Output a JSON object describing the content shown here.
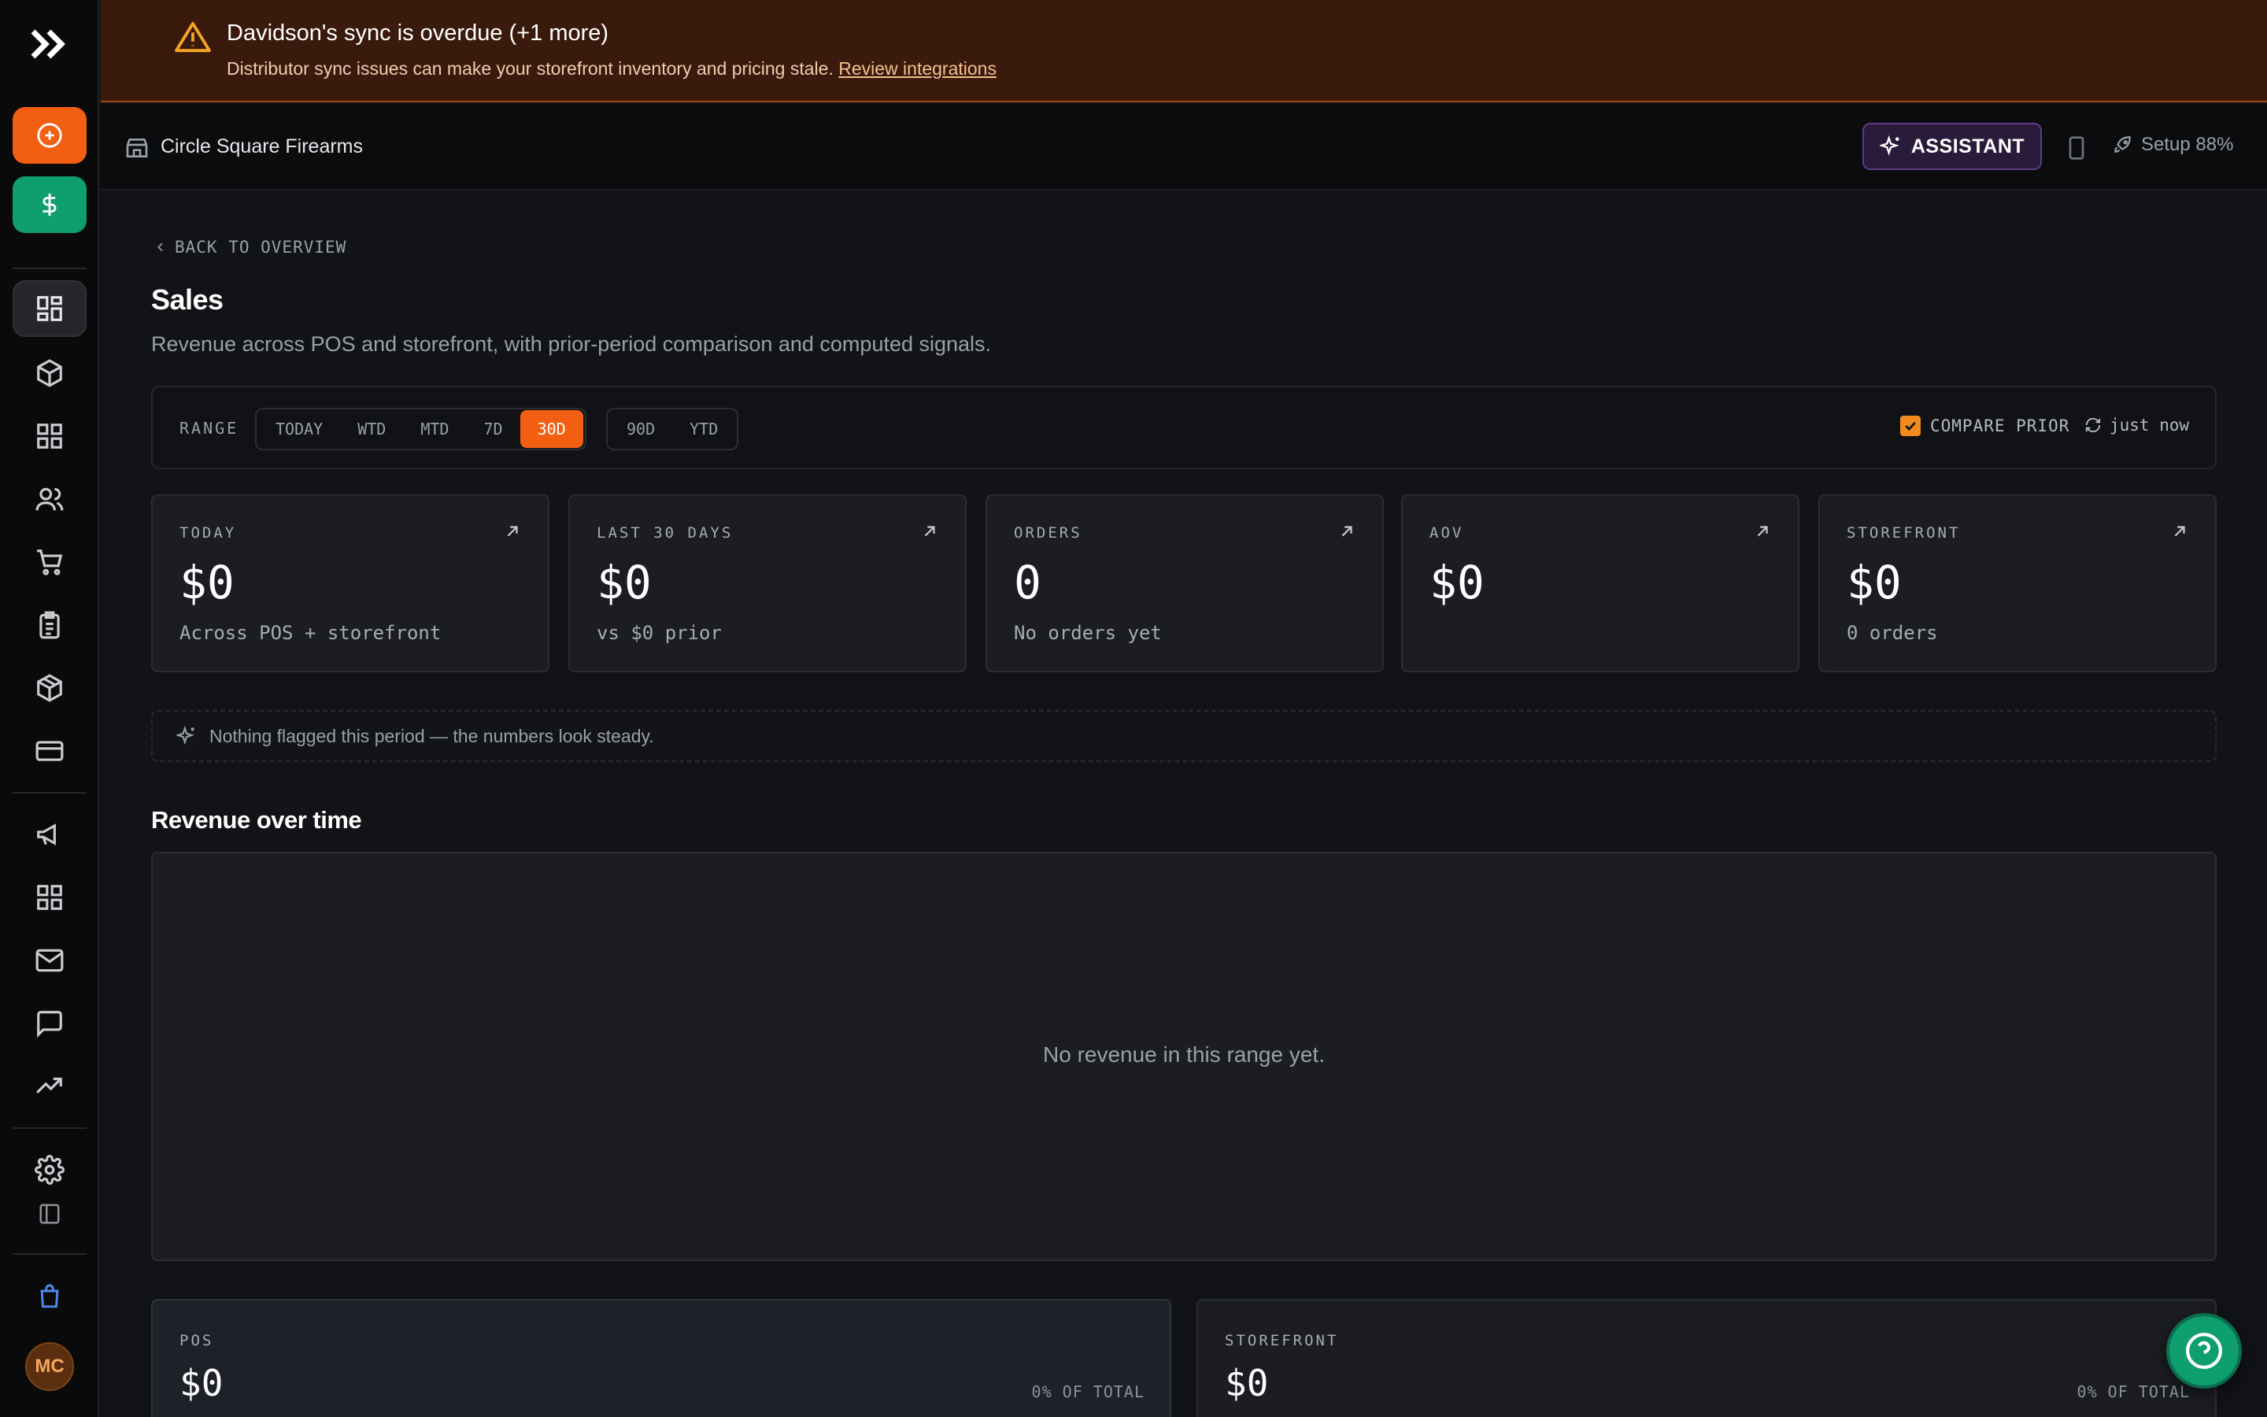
{
  "banner": {
    "title": "Davidson's sync is overdue (+1 more)",
    "text": "Distributor sync issues can make your storefront inventory and pricing stale.",
    "link": "Review integrations"
  },
  "topbar": {
    "store_name": "Circle Square Firearms",
    "assistant_label": "ASSISTANT",
    "setup_label": "Setup 88%"
  },
  "page": {
    "back_label": "BACK TO OVERVIEW",
    "title": "Sales",
    "subtitle": "Revenue across POS and storefront, with prior-period comparison and computed signals."
  },
  "range": {
    "label": "RANGE",
    "options_primary": [
      "TODAY",
      "WTD",
      "MTD",
      "7D",
      "30D"
    ],
    "options_secondary": [
      "90D",
      "YTD"
    ],
    "selected": "30D",
    "compare_label": "COMPARE PRIOR",
    "compare_checked": true,
    "refreshed_label": "just now"
  },
  "kpis": [
    {
      "label": "TODAY",
      "value": "$0",
      "sub": "Across POS + storefront"
    },
    {
      "label": "LAST 30 DAYS",
      "value": "$0",
      "sub": "vs $0 prior"
    },
    {
      "label": "ORDERS",
      "value": "0",
      "sub": "No orders yet"
    },
    {
      "label": "AOV",
      "value": "$0",
      "sub": ""
    },
    {
      "label": "STOREFRONT",
      "value": "$0",
      "sub": "0 orders"
    }
  ],
  "flag_text": "Nothing flagged this period — the numbers look steady.",
  "revenue": {
    "title": "Revenue over time",
    "empty_text": "No revenue in this range yet."
  },
  "channels": [
    {
      "label": "POS",
      "value": "$0",
      "share": "0% OF TOTAL"
    },
    {
      "label": "STOREFRONT",
      "value": "$0",
      "share": "0% OF TOTAL"
    }
  ],
  "user_initials": "MC",
  "colors": {
    "accent_orange": "#f25f13",
    "accent_green": "#0f9e6e",
    "assistant_purple": "#5e3b85",
    "banner_bg": "#3a1a0c"
  }
}
